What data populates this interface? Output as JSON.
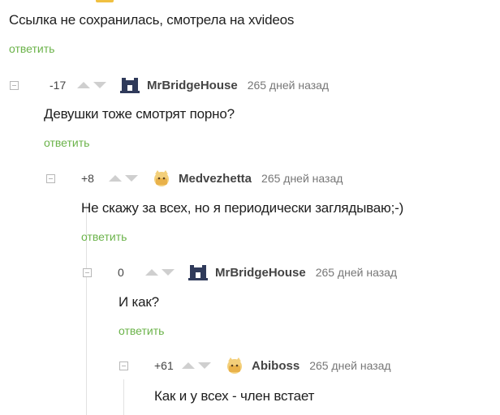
{
  "colors": {
    "reply": "#6bb34a",
    "vote_arrow": "#cfcfcf",
    "text": "#1e1e1e"
  },
  "top_comment": {
    "text": "Ссылка не сохранилась, смотрела на xvideos",
    "reply_label": "ответить"
  },
  "comments": [
    {
      "rating": "-17",
      "author": "MrBridgeHouse",
      "avatar_icon": "castle-icon",
      "time": "265 дней назад",
      "text": "Девушки тоже смотрят порно?",
      "reply_label": "ответить"
    },
    {
      "rating": "+8",
      "author": "Medvezhetta",
      "avatar_icon": "cat-face-icon",
      "time": "265 дней назад",
      "text": "Не скажу за всех, но я периодически заглядываю;-)",
      "reply_label": "ответить"
    },
    {
      "rating": "0",
      "author": "MrBridgeHouse",
      "avatar_icon": "castle-icon",
      "time": "265 дней назад",
      "text": "И как?",
      "reply_label": "ответить"
    },
    {
      "rating": "+61",
      "author": "Abiboss",
      "avatar_icon": "cat-face-icon",
      "time": "265 дней назад",
      "text": "Как и у всех - член встает"
    }
  ]
}
